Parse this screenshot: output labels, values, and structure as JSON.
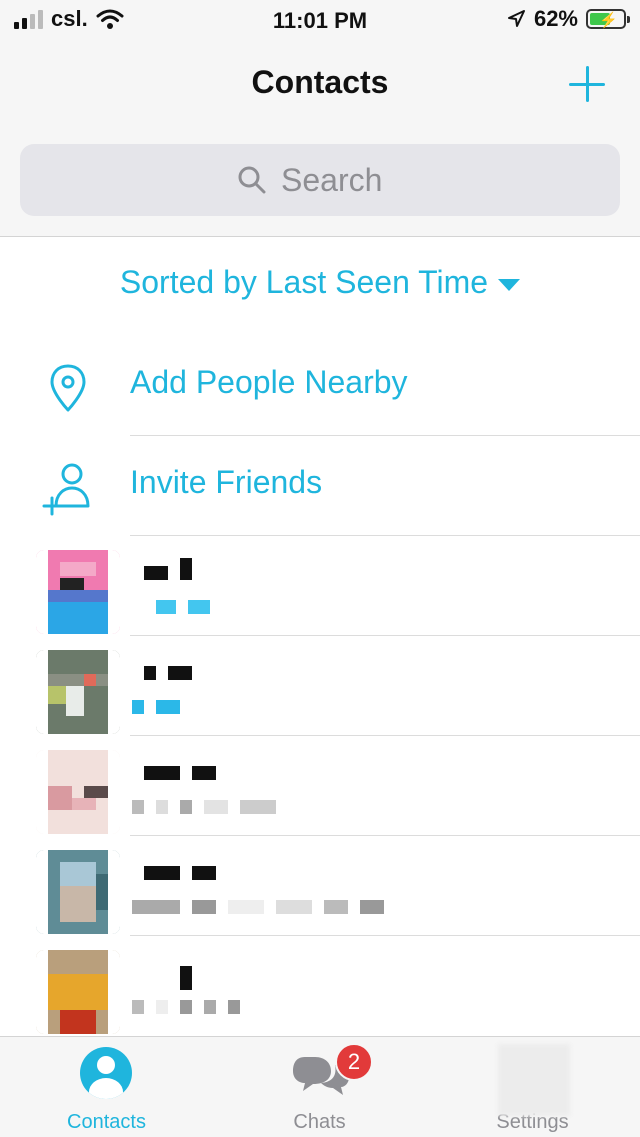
{
  "status_bar": {
    "carrier": "csl.",
    "time": "11:01 PM",
    "battery_percent": "62%",
    "battery_level": 0.62
  },
  "nav": {
    "title": "Contacts"
  },
  "search": {
    "placeholder": "Search"
  },
  "sort": {
    "label": "Sorted by Last Seen Time"
  },
  "actions": [
    {
      "label": "Add People Nearby",
      "icon": "location-pin-icon"
    },
    {
      "label": "Invite Friends",
      "icon": "add-person-icon"
    }
  ],
  "tabs": [
    {
      "label": "Contacts",
      "icon": "contacts-icon",
      "active": true
    },
    {
      "label": "Chats",
      "icon": "chats-icon",
      "badge": "2"
    },
    {
      "label": "Settings",
      "icon": "settings-icon"
    }
  ],
  "colors": {
    "accent": "#1fb5dd",
    "badge": "#e23a3a"
  }
}
